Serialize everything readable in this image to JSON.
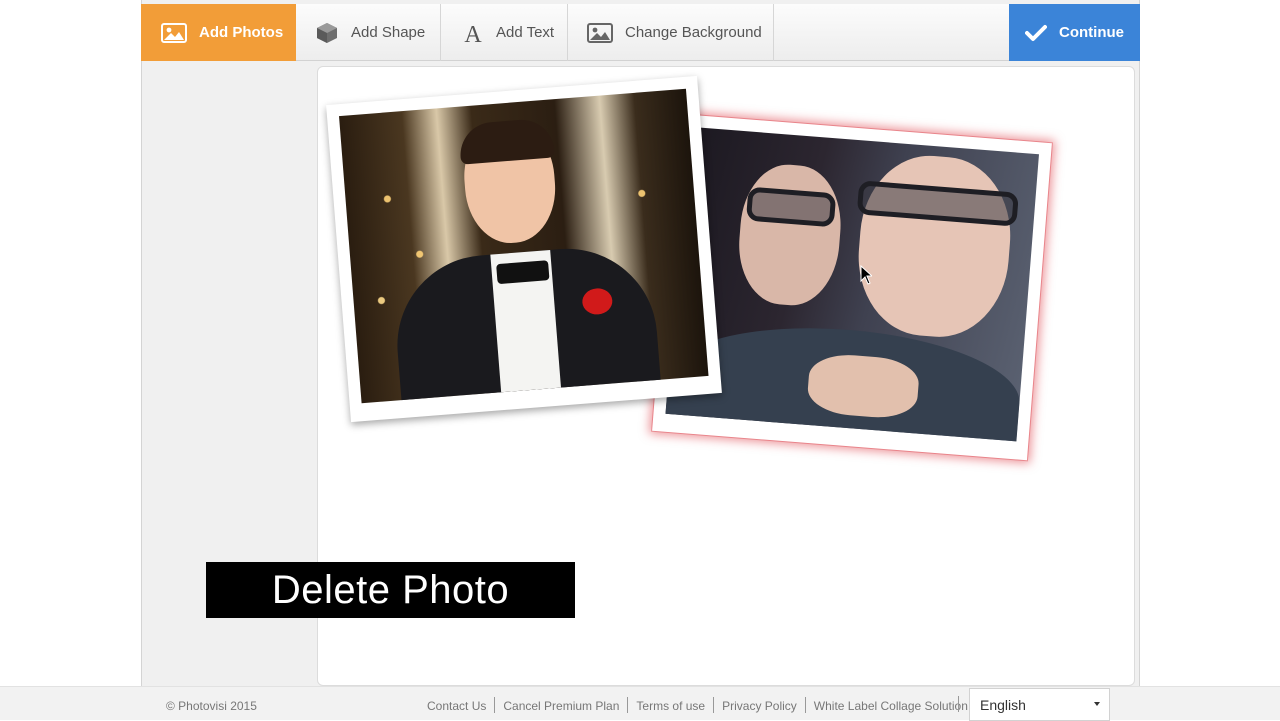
{
  "toolbar": {
    "add_photos_label": "Add Photos",
    "add_shape_label": "Add Shape",
    "add_text_label": "Add Text",
    "change_background_label": "Change Background",
    "continue_label": "Continue"
  },
  "caption": {
    "text": "Delete Photo"
  },
  "footer": {
    "copyright": "© Photovisi 2015",
    "links": [
      "Contact Us",
      "Cancel Premium Plan",
      "Terms of use",
      "Privacy Policy",
      "White Label Collage Solution"
    ],
    "language": "English"
  },
  "colors": {
    "accent_orange": "#f29d38",
    "accent_blue": "#3b84d8",
    "selection_red": "#dc3c46"
  },
  "icons": {
    "add_photos": "image-icon",
    "add_shape": "cube-icon",
    "add_text": "letter-a-icon",
    "change_background": "image-icon",
    "continue": "checkmark-icon"
  }
}
